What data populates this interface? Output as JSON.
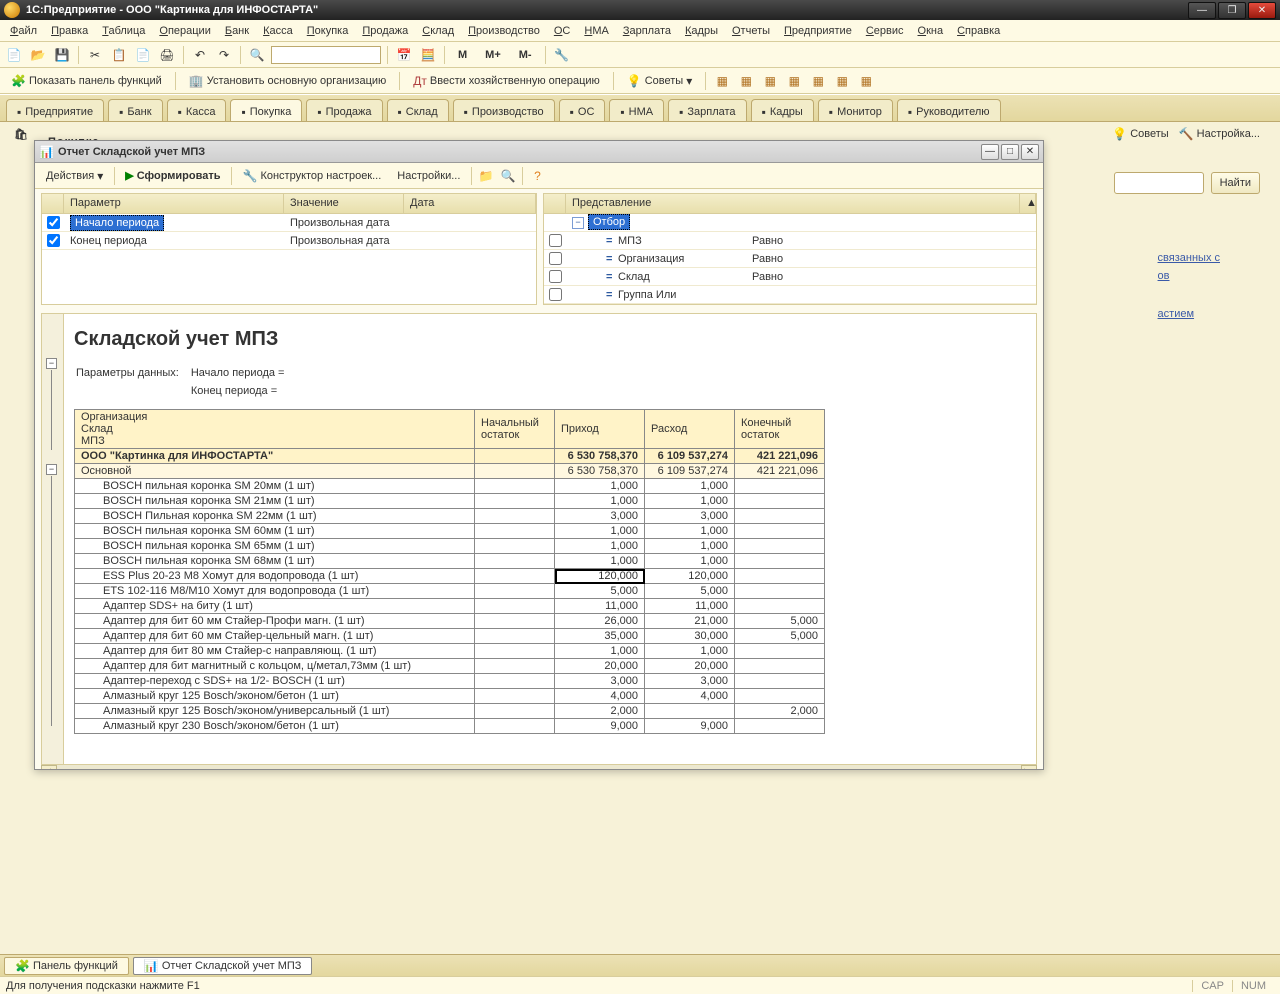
{
  "app_title": "1С:Предприятие - ООО \"Картинка для ИНФОСТАРТА\"",
  "menu": [
    "Файл",
    "Правка",
    "Таблица",
    "Операции",
    "Банк",
    "Касса",
    "Покупка",
    "Продажа",
    "Склад",
    "Производство",
    "ОС",
    "НМА",
    "Зарплата",
    "Кадры",
    "Отчеты",
    "Предприятие",
    "Сервис",
    "Окна",
    "Справка"
  ],
  "toolbar2": {
    "show_panel": "Показать панель функций",
    "set_org": "Установить основную организацию",
    "enter_op": "Ввести хозяйственную операцию",
    "tips": "Советы"
  },
  "modules": [
    "Предприятие",
    "Банк",
    "Касса",
    "Покупка",
    "Продажа",
    "Склад",
    "Производство",
    "ОС",
    "НМА",
    "Зарплата",
    "Кадры",
    "Монитор",
    "Руководителю"
  ],
  "active_module": "Покупка",
  "page_title": "Покупка",
  "side": {
    "tips": "Советы",
    "settings": "Настройка..."
  },
  "search": {
    "btn": "Найти"
  },
  "right_links": [
    "связанных с",
    "ов",
    "астием"
  ],
  "report_window": {
    "title": "Отчет  Складской учет МПЗ",
    "actions": "Действия",
    "form": "Сформировать",
    "constructor": "Конструктор настроек...",
    "settings": "Настройки..."
  },
  "params": {
    "head": [
      "Параметр",
      "Значение",
      "Дата"
    ],
    "rows": [
      {
        "checked": true,
        "name": "Начало периода",
        "value": "Произвольная дата",
        "sel": true
      },
      {
        "checked": true,
        "name": "Конец периода",
        "value": "Произвольная дата"
      }
    ]
  },
  "filter": {
    "head": "Представление",
    "root": "Отбор",
    "rows": [
      {
        "checked": false,
        "name": "МПЗ",
        "cond": "Равно"
      },
      {
        "checked": false,
        "name": "Организация",
        "cond": "Равно"
      },
      {
        "checked": false,
        "name": "Склад",
        "cond": "Равно"
      },
      {
        "checked": false,
        "name": "Группа Или",
        "cond": ""
      }
    ]
  },
  "report": {
    "title": "Складской учет МПЗ",
    "param_label": "Параметры данных:",
    "param_lines": [
      "Начало периода =",
      "Конец периода ="
    ],
    "columns": {
      "c1": "Организация",
      "c1a": "Склад",
      "c1b": "МПЗ",
      "c2": "Начальный остаток",
      "c3": "Приход",
      "c4": "Расход",
      "c5": "Конечный остаток"
    },
    "org": "ООО \"Картинка для ИНФОСТАРТА\"",
    "warehouse": "Основной",
    "totals": {
      "prih": "6 530 758,370",
      "rash": "6 109 537,274",
      "kon": "421 221,096"
    },
    "items": [
      {
        "name": "BOSCH пильная коронка SM 20мм (1 шт)",
        "p": "1,000",
        "r": "1,000"
      },
      {
        "name": "BOSCH пильная коронка SM 21мм (1 шт)",
        "p": "1,000",
        "r": "1,000"
      },
      {
        "name": "BOSCH Пильная коронка SM 22мм (1 шт)",
        "p": "3,000",
        "r": "3,000"
      },
      {
        "name": "BOSCH пильная коронка SM 60мм (1 шт)",
        "p": "1,000",
        "r": "1,000"
      },
      {
        "name": "BOSCH пильная коронка SM 65мм (1 шт)",
        "p": "1,000",
        "r": "1,000"
      },
      {
        "name": "BOSCH пильная коронка SM 68мм (1 шт)",
        "p": "1,000",
        "r": "1,000"
      },
      {
        "name": "ESS Plus 20-23 M8 Хомут для водопровода    (1 шт)",
        "p": "120,000",
        "r": "120,000",
        "active": true
      },
      {
        "name": "ETS 102-116 M8/M10  Хомут для водопровода    (1 шт)",
        "p": "5,000",
        "r": "5,000"
      },
      {
        "name": "Адаптер SDS+ на биту         (1 шт)",
        "p": "11,000",
        "r": "11,000"
      },
      {
        "name": "Адаптер для бит 60 мм Стайер-Профи  магн.    (1 шт)",
        "p": "26,000",
        "r": "21,000",
        "k": "5,000"
      },
      {
        "name": "Адаптер для бит 60 мм Стайер-цельный магн.  (1 шт)",
        "p": "35,000",
        "r": "30,000",
        "k": "5,000"
      },
      {
        "name": "Адаптер для бит 80 мм Стайер-с направляющ.  (1 шт)",
        "p": "1,000",
        "r": "1,000"
      },
      {
        "name": "Адаптер для бит магнитный с кольцом, ц/метал,73мм (1 шт)",
        "p": "20,000",
        "r": "20,000"
      },
      {
        "name": "Адаптер-переход с SDS+ на 1/2- BOSCH       (1 шт)",
        "p": "3,000",
        "r": "3,000"
      },
      {
        "name": "Алмазный круг 125 Bosch/эконом/бетон  (1 шт)",
        "p": "4,000",
        "r": "4,000"
      },
      {
        "name": "Алмазный круг 125 Bosch/эконом/универсальный (1 шт)",
        "p": "2,000",
        "r": "",
        "k": "2,000"
      },
      {
        "name": "Алмазный круг 230 Bosch/эконом/бетон (1 шт)",
        "p": "9,000",
        "r": "9,000"
      }
    ]
  },
  "taskbar": {
    "panel": "Панель функций",
    "report": "Отчет  Складской учет МПЗ"
  },
  "status": {
    "hint": "Для получения подсказки нажмите F1",
    "cap": "CAP",
    "num": "NUM"
  }
}
